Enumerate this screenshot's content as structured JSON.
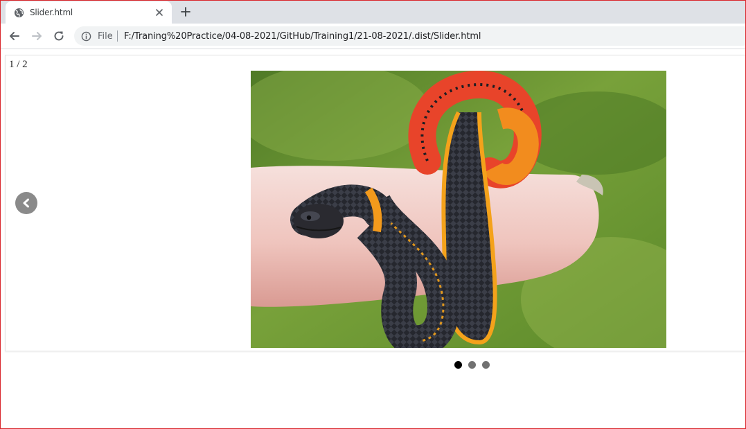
{
  "browser": {
    "tab": {
      "title": "Slider.html",
      "favicon": "globe-icon"
    },
    "new_tab_icon": "plus-icon",
    "toolbar": {
      "back_icon": "arrow-left-icon",
      "forward_icon": "arrow-right-icon",
      "reload_icon": "reload-icon",
      "site_info_icon": "info-icon",
      "scheme_label": "File",
      "url": "F:/Traning%20Practice/04-08-2021/GitHub/Training1/21-08-2021/.dist/Slider.html"
    }
  },
  "slider": {
    "counter": "1 / 2",
    "prev_icon": "chevron-left-icon",
    "image_subject": "ring-necked snake coiled around a finger",
    "dots": {
      "count": 3,
      "active_index": 0
    }
  },
  "colors": {
    "frame_border": "#d9262b",
    "tab_strip": "#dee1e6",
    "omnibox": "#f1f3f4",
    "dot_active": "#000000",
    "dot_inactive": "#717171",
    "prev_button": "#8a8a8a"
  }
}
